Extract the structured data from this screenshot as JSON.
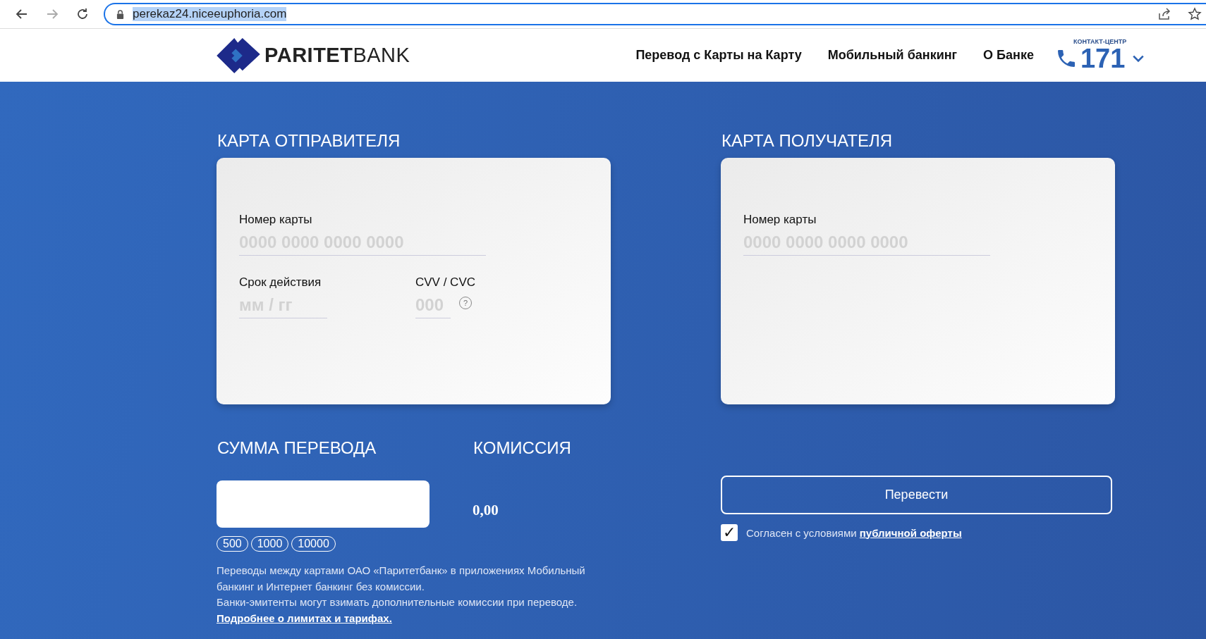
{
  "browser": {
    "url": "perekaz24.niceeuphoria.com",
    "url_selected": true,
    "forward_disabled": true
  },
  "header": {
    "logo": "**PARITET**BANK",
    "nav": [
      "Перевод с Карты на Карту",
      "Мобильный банкинг",
      "О Банке"
    ],
    "contact": {
      "label": "КОНТАКТ-ЦЕНТР",
      "number": "171"
    }
  },
  "sender": {
    "title": "КАРТА ОТПРАВИТЕЛЯ",
    "card_number": {
      "label": "Номер карты",
      "placeholder": "0000 0000 0000 0000"
    },
    "expiry": {
      "label": "Срок действия",
      "placeholder": "мм / гг"
    },
    "cvv": {
      "label": "CVV / CVC",
      "placeholder": "000",
      "help": "?"
    }
  },
  "recipient": {
    "title": "КАРТА ПОЛУЧАТЕЛЯ",
    "card_number": {
      "label": "Номер карты",
      "placeholder": "0000 0000 0000 0000"
    }
  },
  "amount": {
    "title": "СУММА ПЕРЕВОДА",
    "presets": [
      "500",
      "1000",
      "10000"
    ]
  },
  "commission": {
    "title": "КОМИССИЯ",
    "value": "0,00"
  },
  "notes": [
    "Переводы между картами ОАО «Паритетбанк» в приложениях Мобильный банкинг и Интернет банкинг без комиссии.",
    "Банки-эмитенты могут взимать дополнительные комиссии при переводе."
  ],
  "notes_link": "Подробнее о лимитах и тарифах.",
  "submit": "Перевести",
  "agreement": {
    "checked": true,
    "check_mark": "✓",
    "text": "Согласен с условиями ",
    "link": "публичной оферты"
  }
}
